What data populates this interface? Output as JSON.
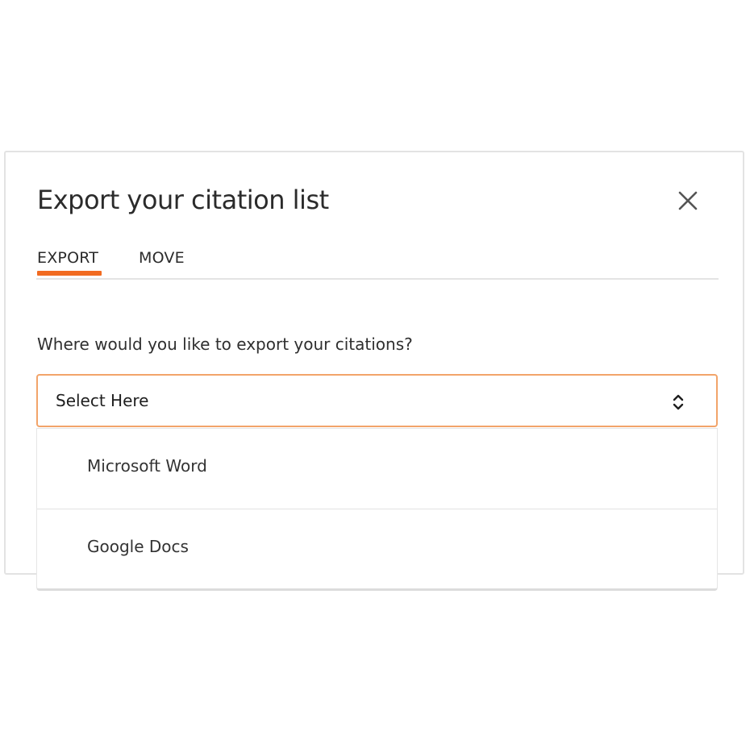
{
  "dialog": {
    "title": "Export your citation list",
    "close_icon": "close-icon"
  },
  "tabs": [
    {
      "label": "EXPORT",
      "active": true
    },
    {
      "label": "MOVE",
      "active": false
    }
  ],
  "export": {
    "prompt": "Where would you like to export your citations?",
    "select": {
      "value": "Select Here",
      "icon": "chevron-up-down-icon"
    },
    "options": [
      {
        "label": "Microsoft Word"
      },
      {
        "label": "Google Docs"
      }
    ]
  },
  "colors": {
    "accent": "#f26b21",
    "select_border": "#f2a46a",
    "text": "#2b2b2b",
    "divider": "#e4e4e4"
  }
}
